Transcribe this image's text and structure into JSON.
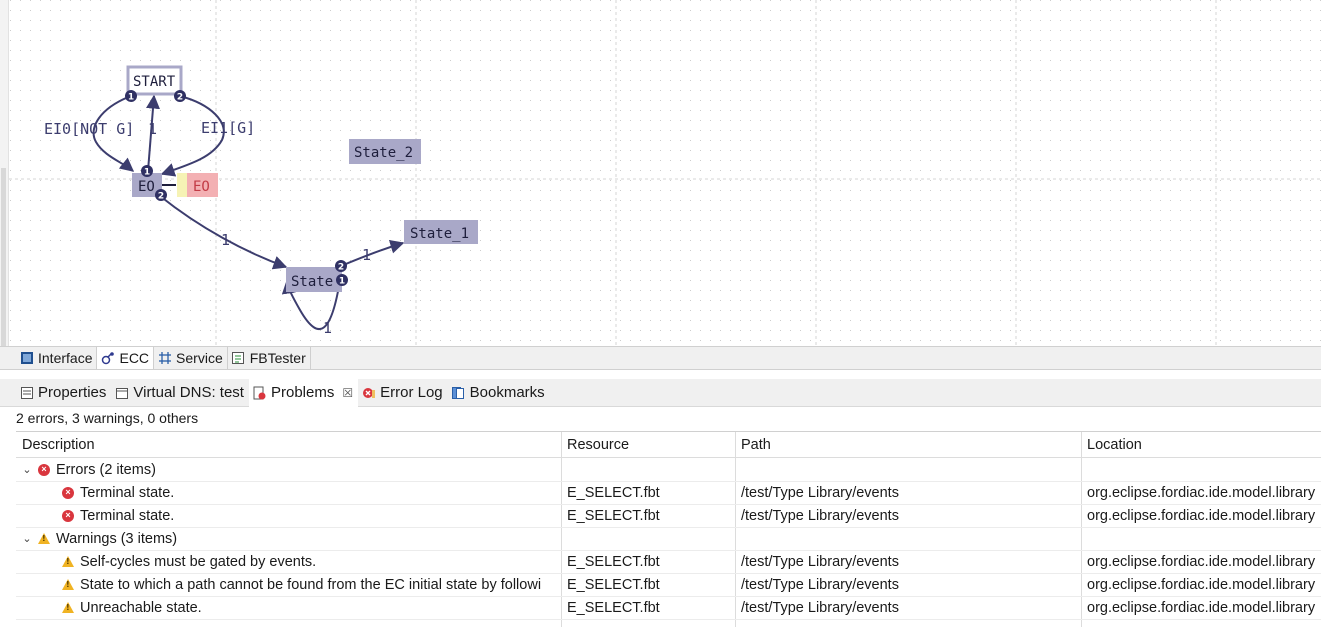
{
  "diagram": {
    "states": {
      "start": "START",
      "eo": "EO",
      "state": "State",
      "state1": "State_1",
      "state2": "State_2"
    },
    "action_output": "EO",
    "transitions": {
      "start_to_eo_left": "EI0[NOT G]",
      "eo_to_start": "1",
      "start_to_eo_right": "EI1[G]",
      "eo_to_state": "1",
      "state_to_state1": "1",
      "state_self": "1"
    },
    "badges": {
      "start_left": "1",
      "start_right": "2",
      "eo_top": "1",
      "eo_bottom": "2",
      "state_top": "2",
      "state_right": "1"
    },
    "colors": {
      "state_fill": "#a9a8c8",
      "edge": "#3c3d6e",
      "action_yellow": "#f6f3b5",
      "action_red": "#f3b0b3"
    }
  },
  "editor_tabs": [
    {
      "label": "Interface",
      "icon": "interface-icon"
    },
    {
      "label": "ECC",
      "icon": "ecc-icon"
    },
    {
      "label": "Service",
      "icon": "service-icon"
    },
    {
      "label": "FBTester",
      "icon": "fbtester-icon"
    }
  ],
  "view_tabs": [
    {
      "label": "Properties",
      "icon": "properties-icon"
    },
    {
      "label": "Virtual DNS: test",
      "icon": "virtual-dns-icon"
    },
    {
      "label": "Problems",
      "icon": "problems-icon",
      "close": "☒"
    },
    {
      "label": "Error Log",
      "icon": "error-log-icon"
    },
    {
      "label": "Bookmarks",
      "icon": "bookmarks-icon"
    }
  ],
  "problems": {
    "summary": "2 errors, 3 warnings, 0 others",
    "columns": [
      "Description",
      "Resource",
      "Path",
      "Location"
    ],
    "groups": [
      {
        "label": "Errors (2 items)",
        "type": "error",
        "items": [
          {
            "description": "Terminal state.",
            "resource": "E_SELECT.fbt",
            "path": "/test/Type Library/events",
            "location": "org.eclipse.fordiac.ide.model.library"
          },
          {
            "description": "Terminal state.",
            "resource": "E_SELECT.fbt",
            "path": "/test/Type Library/events",
            "location": "org.eclipse.fordiac.ide.model.library"
          }
        ]
      },
      {
        "label": "Warnings (3 items)",
        "type": "warning",
        "items": [
          {
            "description": "Self-cycles must be gated by events.",
            "resource": "E_SELECT.fbt",
            "path": "/test/Type Library/events",
            "location": "org.eclipse.fordiac.ide.model.library"
          },
          {
            "description": "State to which a path cannot be found from the EC initial state by followi",
            "resource": "E_SELECT.fbt",
            "path": "/test/Type Library/events",
            "location": "org.eclipse.fordiac.ide.model.library"
          },
          {
            "description": "Unreachable state.",
            "resource": "E_SELECT.fbt",
            "path": "/test/Type Library/events",
            "location": "org.eclipse.fordiac.ide.model.library"
          }
        ]
      }
    ]
  }
}
